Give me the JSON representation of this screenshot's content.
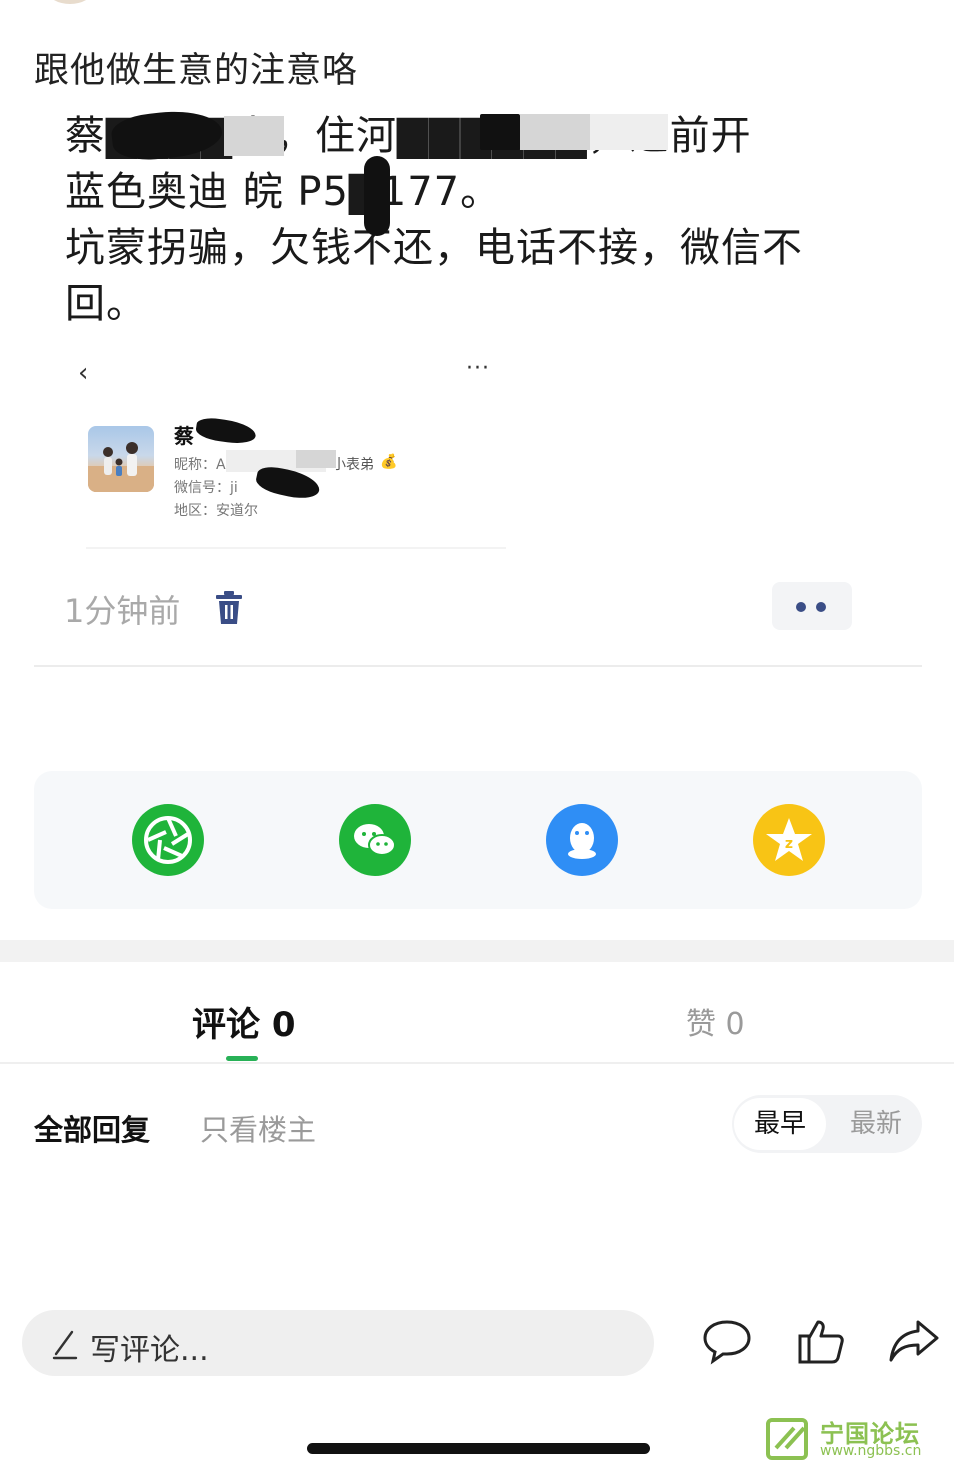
{
  "post": {
    "title": "跟他做生意的注意咯",
    "lines": [
      "蔡▇▇▇▇人，住河▇▇▇▇▇▇，之前开",
      "蓝色奥迪  皖 P5▇177。",
      "坑蒙拐骗，欠钱不还，电话不接，微信不",
      "回。"
    ],
    "time": "1分钟前"
  },
  "embedded_profile": {
    "back": "‹",
    "more": "···",
    "name": "蔡",
    "nickname": "昵称：A",
    "nickname_suffix": "小表弟",
    "wechat_id": "微信号：ji",
    "region": "地区：安道尔"
  },
  "share": {
    "items": [
      "moments-icon",
      "wechat-icon",
      "qq-icon",
      "qzone-icon"
    ],
    "colors": {
      "moments": "#1fb43a",
      "wechat": "#1fb43a",
      "qq": "#2f8ef5",
      "qzone": "#f8c415"
    }
  },
  "tabs": {
    "comment": "评论 0",
    "like": "赞 0"
  },
  "filters": {
    "all": "全部回复",
    "owner_only": "只看楼主",
    "earliest": "最早",
    "latest": "最新"
  },
  "bottom_bar": {
    "placeholder": "写评论..."
  },
  "watermark": {
    "name": "宁国论坛",
    "url": "www.ngbbs.cn"
  }
}
